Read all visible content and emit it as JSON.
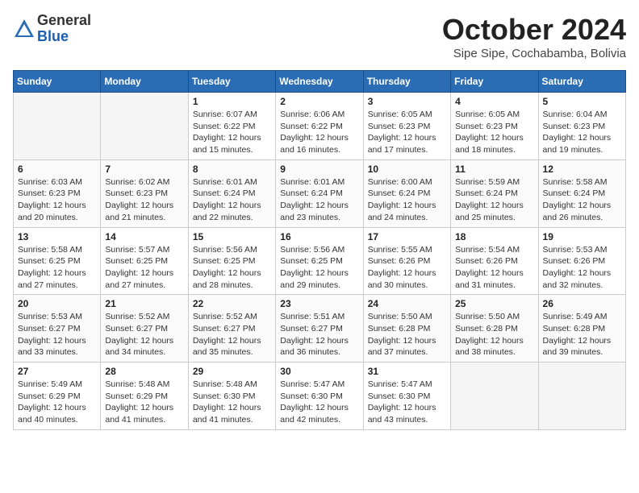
{
  "logo": {
    "general": "General",
    "blue": "Blue"
  },
  "title": "October 2024",
  "subtitle": "Sipe Sipe, Cochabamba, Bolivia",
  "days_of_week": [
    "Sunday",
    "Monday",
    "Tuesday",
    "Wednesday",
    "Thursday",
    "Friday",
    "Saturday"
  ],
  "weeks": [
    [
      {
        "day": "",
        "info": ""
      },
      {
        "day": "",
        "info": ""
      },
      {
        "day": "1",
        "info": "Sunrise: 6:07 AM\nSunset: 6:22 PM\nDaylight: 12 hours and 15 minutes."
      },
      {
        "day": "2",
        "info": "Sunrise: 6:06 AM\nSunset: 6:22 PM\nDaylight: 12 hours and 16 minutes."
      },
      {
        "day": "3",
        "info": "Sunrise: 6:05 AM\nSunset: 6:23 PM\nDaylight: 12 hours and 17 minutes."
      },
      {
        "day": "4",
        "info": "Sunrise: 6:05 AM\nSunset: 6:23 PM\nDaylight: 12 hours and 18 minutes."
      },
      {
        "day": "5",
        "info": "Sunrise: 6:04 AM\nSunset: 6:23 PM\nDaylight: 12 hours and 19 minutes."
      }
    ],
    [
      {
        "day": "6",
        "info": "Sunrise: 6:03 AM\nSunset: 6:23 PM\nDaylight: 12 hours and 20 minutes."
      },
      {
        "day": "7",
        "info": "Sunrise: 6:02 AM\nSunset: 6:23 PM\nDaylight: 12 hours and 21 minutes."
      },
      {
        "day": "8",
        "info": "Sunrise: 6:01 AM\nSunset: 6:24 PM\nDaylight: 12 hours and 22 minutes."
      },
      {
        "day": "9",
        "info": "Sunrise: 6:01 AM\nSunset: 6:24 PM\nDaylight: 12 hours and 23 minutes."
      },
      {
        "day": "10",
        "info": "Sunrise: 6:00 AM\nSunset: 6:24 PM\nDaylight: 12 hours and 24 minutes."
      },
      {
        "day": "11",
        "info": "Sunrise: 5:59 AM\nSunset: 6:24 PM\nDaylight: 12 hours and 25 minutes."
      },
      {
        "day": "12",
        "info": "Sunrise: 5:58 AM\nSunset: 6:24 PM\nDaylight: 12 hours and 26 minutes."
      }
    ],
    [
      {
        "day": "13",
        "info": "Sunrise: 5:58 AM\nSunset: 6:25 PM\nDaylight: 12 hours and 27 minutes."
      },
      {
        "day": "14",
        "info": "Sunrise: 5:57 AM\nSunset: 6:25 PM\nDaylight: 12 hours and 27 minutes."
      },
      {
        "day": "15",
        "info": "Sunrise: 5:56 AM\nSunset: 6:25 PM\nDaylight: 12 hours and 28 minutes."
      },
      {
        "day": "16",
        "info": "Sunrise: 5:56 AM\nSunset: 6:25 PM\nDaylight: 12 hours and 29 minutes."
      },
      {
        "day": "17",
        "info": "Sunrise: 5:55 AM\nSunset: 6:26 PM\nDaylight: 12 hours and 30 minutes."
      },
      {
        "day": "18",
        "info": "Sunrise: 5:54 AM\nSunset: 6:26 PM\nDaylight: 12 hours and 31 minutes."
      },
      {
        "day": "19",
        "info": "Sunrise: 5:53 AM\nSunset: 6:26 PM\nDaylight: 12 hours and 32 minutes."
      }
    ],
    [
      {
        "day": "20",
        "info": "Sunrise: 5:53 AM\nSunset: 6:27 PM\nDaylight: 12 hours and 33 minutes."
      },
      {
        "day": "21",
        "info": "Sunrise: 5:52 AM\nSunset: 6:27 PM\nDaylight: 12 hours and 34 minutes."
      },
      {
        "day": "22",
        "info": "Sunrise: 5:52 AM\nSunset: 6:27 PM\nDaylight: 12 hours and 35 minutes."
      },
      {
        "day": "23",
        "info": "Sunrise: 5:51 AM\nSunset: 6:27 PM\nDaylight: 12 hours and 36 minutes."
      },
      {
        "day": "24",
        "info": "Sunrise: 5:50 AM\nSunset: 6:28 PM\nDaylight: 12 hours and 37 minutes."
      },
      {
        "day": "25",
        "info": "Sunrise: 5:50 AM\nSunset: 6:28 PM\nDaylight: 12 hours and 38 minutes."
      },
      {
        "day": "26",
        "info": "Sunrise: 5:49 AM\nSunset: 6:28 PM\nDaylight: 12 hours and 39 minutes."
      }
    ],
    [
      {
        "day": "27",
        "info": "Sunrise: 5:49 AM\nSunset: 6:29 PM\nDaylight: 12 hours and 40 minutes."
      },
      {
        "day": "28",
        "info": "Sunrise: 5:48 AM\nSunset: 6:29 PM\nDaylight: 12 hours and 41 minutes."
      },
      {
        "day": "29",
        "info": "Sunrise: 5:48 AM\nSunset: 6:30 PM\nDaylight: 12 hours and 41 minutes."
      },
      {
        "day": "30",
        "info": "Sunrise: 5:47 AM\nSunset: 6:30 PM\nDaylight: 12 hours and 42 minutes."
      },
      {
        "day": "31",
        "info": "Sunrise: 5:47 AM\nSunset: 6:30 PM\nDaylight: 12 hours and 43 minutes."
      },
      {
        "day": "",
        "info": ""
      },
      {
        "day": "",
        "info": ""
      }
    ]
  ]
}
